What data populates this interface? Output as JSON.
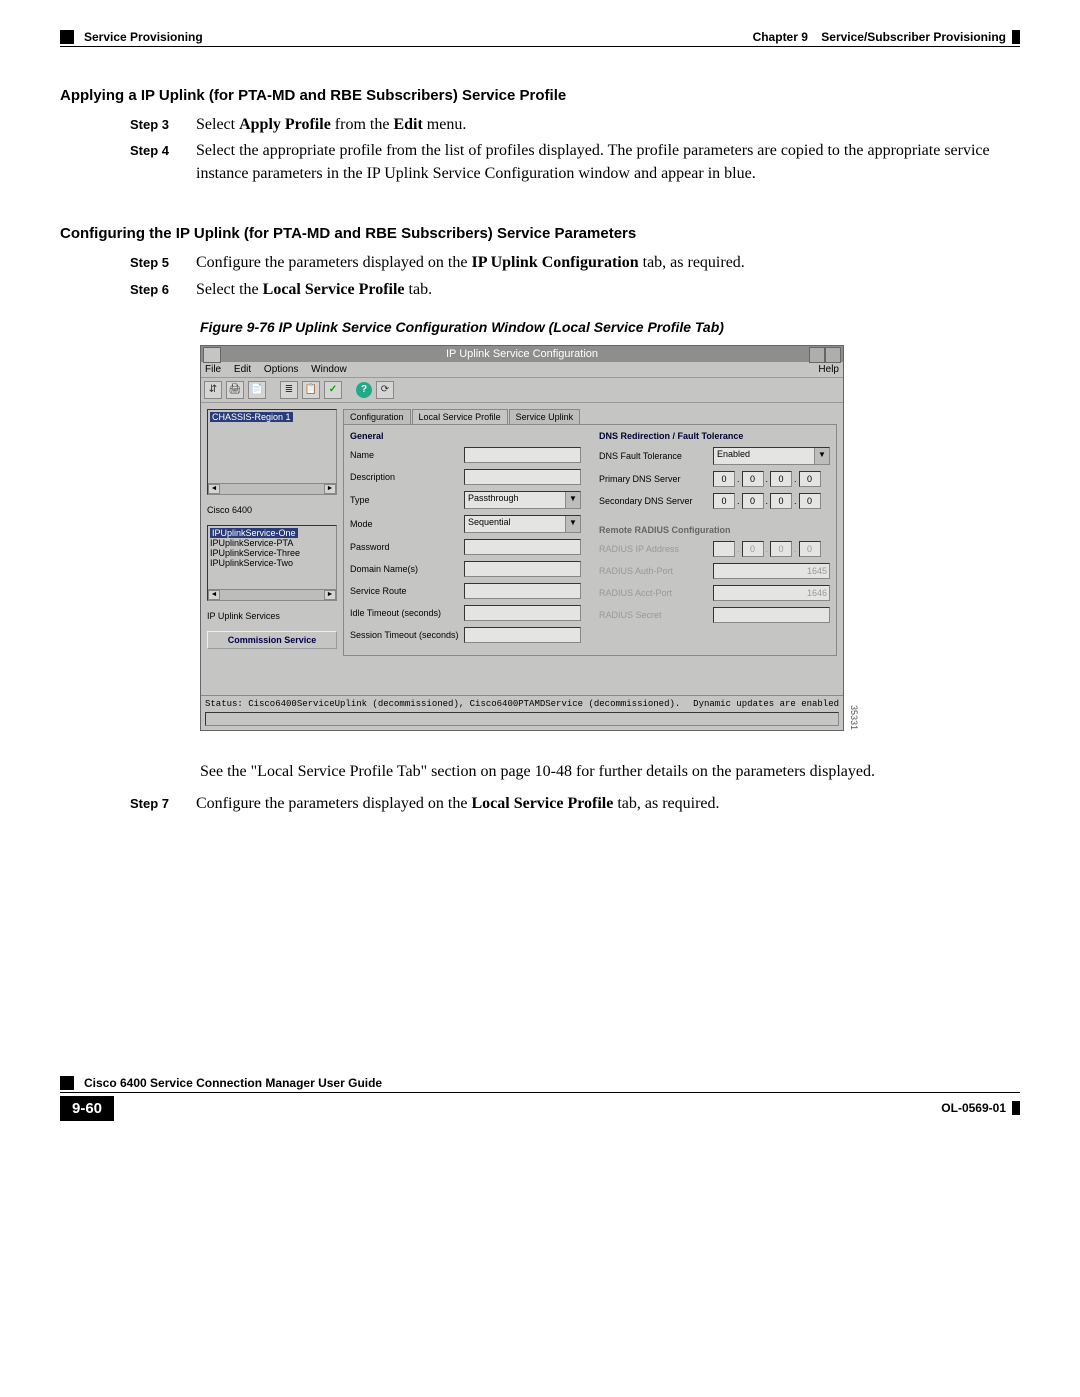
{
  "header": {
    "left": "Service Provisioning",
    "right_chapter": "Chapter 9",
    "right_title": "Service/Subscriber Provisioning"
  },
  "section1": {
    "heading": "Applying a IP Uplink (for PTA-MD and RBE Subscribers) Service Profile",
    "step3_label": "Step 3",
    "step3_pre": "Select ",
    "step3_b1": "Apply Profile",
    "step3_mid": " from the ",
    "step3_b2": "Edit",
    "step3_post": " menu.",
    "step4_label": "Step 4",
    "step4_text": "Select the appropriate profile from the list of profiles displayed. The profile parameters are copied to the appropriate service instance parameters in the IP Uplink Service Configuration window and appear in blue."
  },
  "section2": {
    "heading": "Configuring the IP Uplink (for PTA-MD and RBE Subscribers) Service Parameters",
    "step5_label": "Step 5",
    "step5_pre": "Configure the parameters displayed on the ",
    "step5_b": "IP Uplink Configuration",
    "step5_post": " tab, as required.",
    "step6_label": "Step 6",
    "step6_pre": "Select the ",
    "step6_b": "Local Service Profile",
    "step6_post": " tab."
  },
  "figure": {
    "caption": "Figure 9-76   IP Uplink Service Configuration Window (Local Service Profile Tab)",
    "side_number": "35331"
  },
  "app": {
    "title": "IP Uplink Service Configuration",
    "menus": {
      "file": "File",
      "edit": "Edit",
      "options": "Options",
      "window": "Window",
      "help": "Help"
    },
    "toolbar_icons": [
      "⇵",
      "🖨",
      "📄",
      "≣",
      "📋",
      "✓",
      "?",
      "⟳"
    ],
    "left": {
      "tree_selected": "CHASSIS-Region 1",
      "mid_label": "Cisco 6400",
      "svc_items": [
        "IPUplinkService-One",
        "IPUplinkService-PTA",
        "IPUplinkService-Three",
        "IPUplinkService-Two"
      ],
      "lower_label": "IP Uplink Services",
      "button": "Commission Service"
    },
    "tabs": {
      "t1": "Configuration",
      "t2": "Local Service Profile",
      "t3": "Service Uplink"
    },
    "general": {
      "heading": "General",
      "name": "Name",
      "description": "Description",
      "type": "Type",
      "type_val": "Passthrough",
      "mode": "Mode",
      "mode_val": "Sequential",
      "password": "Password",
      "domain": "Domain Name(s)",
      "route": "Service Route",
      "idle": "Idle Timeout (seconds)",
      "session": "Session Timeout (seconds)"
    },
    "dns": {
      "heading": "DNS Redirection / Fault Tolerance",
      "fault": "DNS Fault Tolerance",
      "fault_val": "Enabled",
      "primary": "Primary DNS Server",
      "secondary": "Secondary DNS Server"
    },
    "radius": {
      "heading": "Remote RADIUS Configuration",
      "ip": "RADIUS IP Address",
      "auth": "RADIUS Auth-Port",
      "auth_val": "1645",
      "acct": "RADIUS Acct-Port",
      "acct_val": "1646",
      "secret": "RADIUS Secret"
    },
    "status_left": "Status: Cisco6400ServiceUplink (decommissioned), Cisco6400PTAMDService (decommissioned).",
    "status_right": "Dynamic updates are enabled"
  },
  "post_figure": {
    "para": "See the \"Local Service Profile Tab\" section on page 10-48 for further details on the parameters displayed.",
    "step7_label": "Step 7",
    "step7_pre": "Configure the parameters displayed on the ",
    "step7_b": "Local Service Profile",
    "step7_post": " tab, as required."
  },
  "footer": {
    "guide": "Cisco 6400 Service Connection Manager User Guide",
    "page": "9-60",
    "doc": "OL-0569-01"
  }
}
